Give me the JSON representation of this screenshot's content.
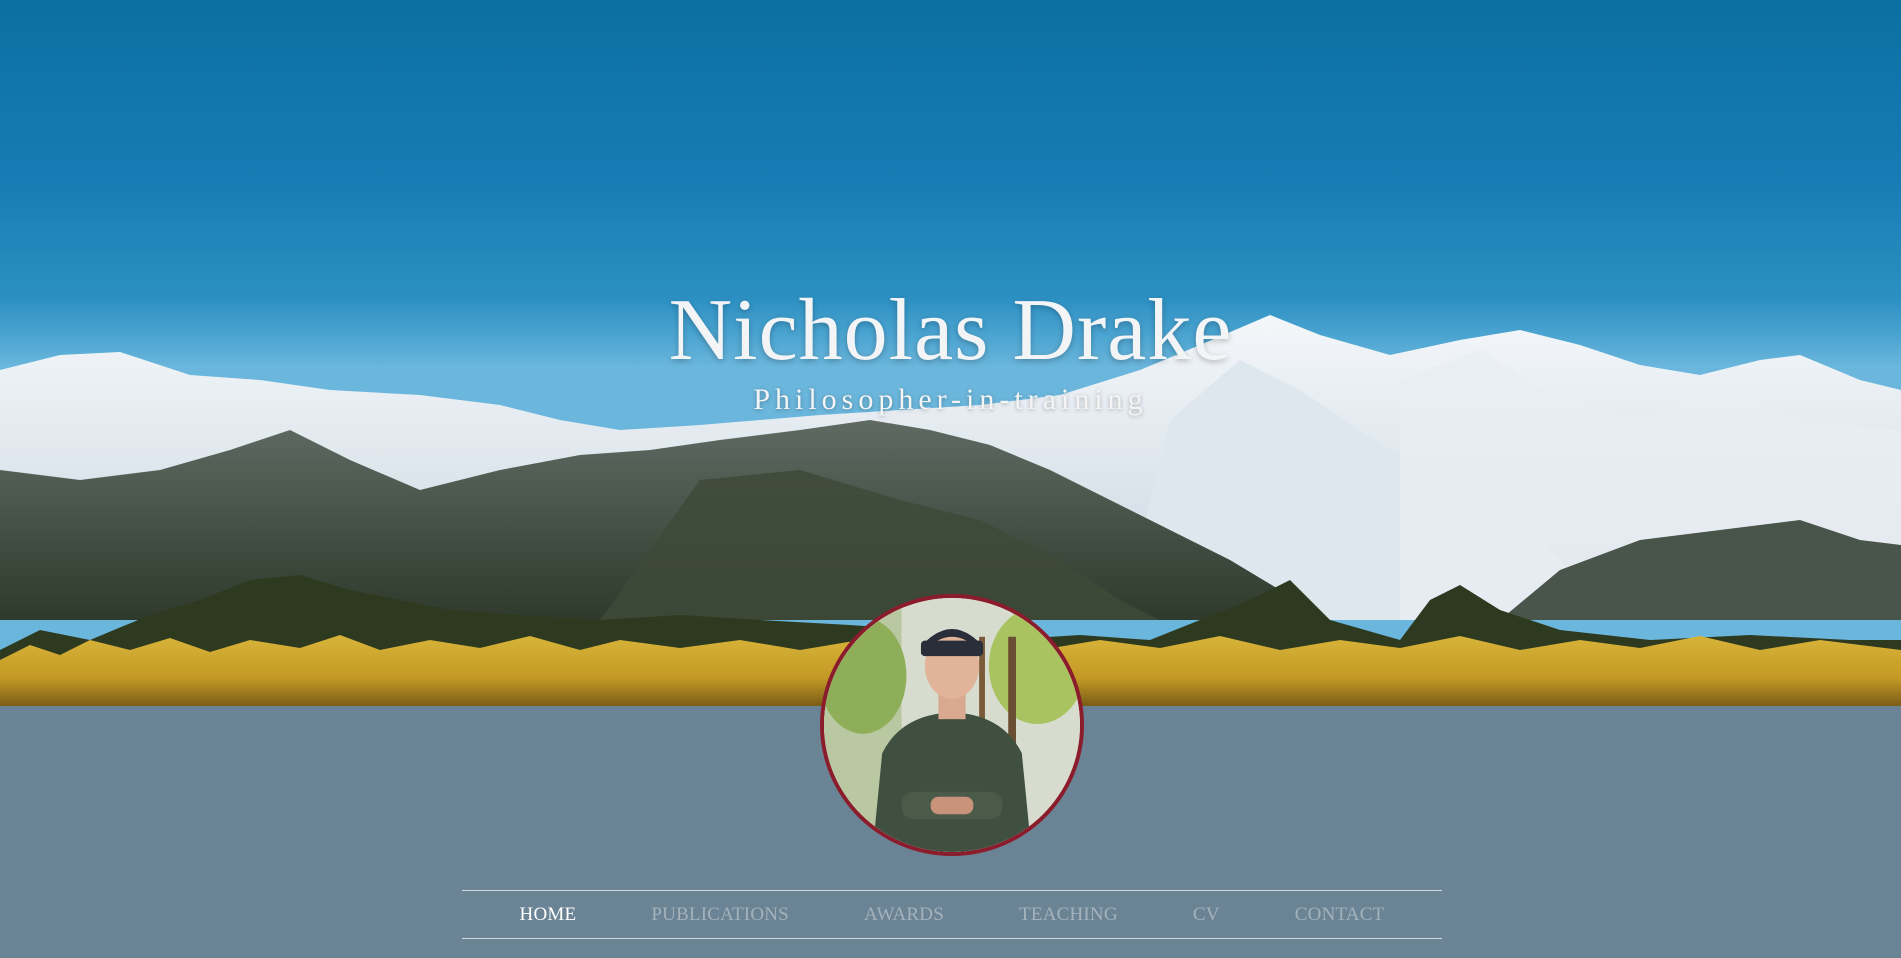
{
  "header": {
    "name": "Nicholas Drake",
    "tagline": "Philosopher-in-training"
  },
  "profile": {
    "photo_alt": "Portrait photo"
  },
  "nav": {
    "items": [
      {
        "label": "HOME",
        "active": true
      },
      {
        "label": "PUBLICATIONS",
        "active": false
      },
      {
        "label": "AWARDS",
        "active": false
      },
      {
        "label": "TEACHING",
        "active": false
      },
      {
        "label": "CV",
        "active": false
      },
      {
        "label": "CONTACT",
        "active": false
      }
    ]
  },
  "colors": {
    "sky": "#157db3",
    "page_background": "#6b8495",
    "nav_active": "#ffffff",
    "nav_inactive": "#a4b2bc",
    "avatar_border": "#8b1c2c"
  }
}
